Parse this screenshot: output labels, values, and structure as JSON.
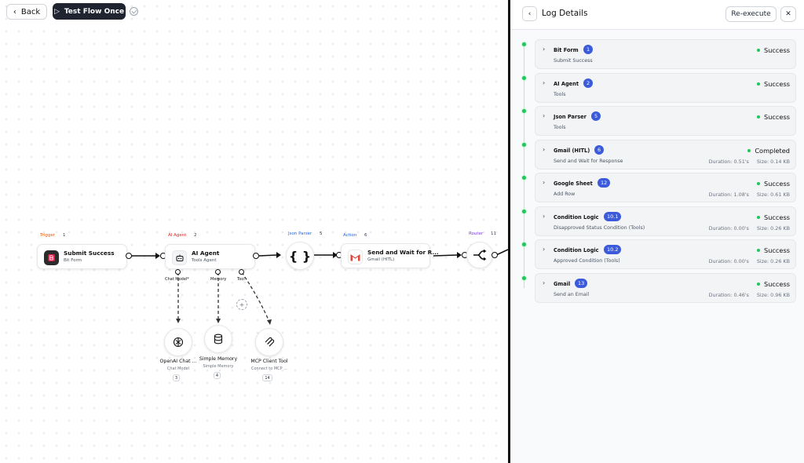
{
  "toolbar": {
    "back_label": "Back",
    "test_label": "Test Flow Once"
  },
  "nodes": {
    "trigger": {
      "category": "Trigger",
      "num": "1",
      "title": "Submit Success",
      "subtitle": "Bit Form"
    },
    "agent": {
      "category": "AI Agent",
      "num": "2",
      "title": "AI Agent",
      "subtitle": "Tools Agent"
    },
    "json": {
      "category": "Json Parser",
      "num": "5"
    },
    "gmail_hitl": {
      "category": "Action",
      "num": "6",
      "title": "Send and Wait for R...",
      "subtitle": "Gmail (HITL)"
    },
    "router": {
      "category": "Router",
      "num": "11"
    }
  },
  "ports": {
    "chat_model": "Chat Model*",
    "memory": "Memory",
    "tool": "Tool"
  },
  "subnodes": {
    "openai": {
      "title": "OpenAI Chat ...",
      "subtitle": "Chat Model",
      "num": "3"
    },
    "memory": {
      "title": "Simple Memory",
      "subtitle": "Simple Memory",
      "num": "4"
    },
    "mcp": {
      "title": "MCP Client Tool",
      "subtitle": "Connect to MCP ...",
      "num": "14"
    }
  },
  "panel": {
    "title": "Log Details",
    "reexecute_label": "Re-execute",
    "logs": [
      {
        "title": "Bit Form",
        "badge": "1",
        "subtitle": "Submit Success",
        "status": "Success",
        "duration": "",
        "size": ""
      },
      {
        "title": "AI Agent",
        "badge": "2",
        "subtitle": "Tools",
        "status": "Success",
        "duration": "",
        "size": ""
      },
      {
        "title": "Json Parser",
        "badge": "5",
        "subtitle": "Tools",
        "status": "Success",
        "duration": "",
        "size": ""
      },
      {
        "title": "Gmail (HITL)",
        "badge": "6",
        "subtitle": "Send and Wait for Response",
        "status": "Completed",
        "duration": "Duration: 0.51's",
        "size": "Size: 0.14 KB"
      },
      {
        "title": "Google Sheet",
        "badge": "12",
        "subtitle": "Add Row",
        "status": "Success",
        "duration": "Duration: 1.08's",
        "size": "Size: 0.61 KB"
      },
      {
        "title": "Condition Logic",
        "badge": "10.1",
        "subtitle": "Disapproved Status Condition (Tools)",
        "status": "Success",
        "duration": "Duration: 0.00's",
        "size": "Size: 0.26 KB"
      },
      {
        "title": "Condition Logic",
        "badge": "10.2",
        "subtitle": "Approved Condition (Tools)",
        "status": "Success",
        "duration": "Duration: 0.00's",
        "size": "Size: 0.26 KB"
      },
      {
        "title": "Gmail",
        "badge": "13",
        "subtitle": "Send an Email",
        "status": "Success",
        "duration": "Duration: 0.46's",
        "size": "Size: 0.96 KB"
      }
    ]
  },
  "colors": {
    "success": "#22c55e",
    "badge": "#3b5bdb",
    "trigger_label": "#ea580c",
    "agent_label": "#dc2626",
    "json_label": "#2563eb",
    "action_label": "#2563eb",
    "router_label": "#7c3aed"
  }
}
